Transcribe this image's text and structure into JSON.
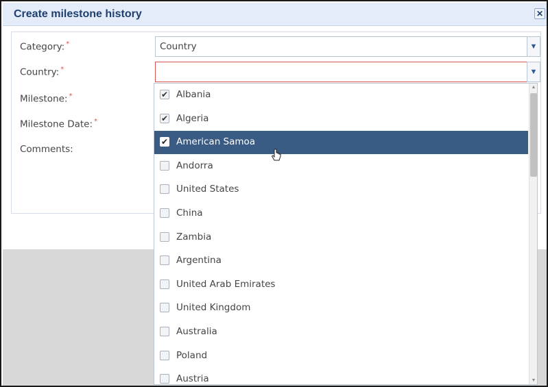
{
  "dialog": {
    "title": "Create milestone history",
    "close_glyph": "✕"
  },
  "form": {
    "category": {
      "label": "Category:",
      "required_mark": "*",
      "value": "Country"
    },
    "country": {
      "label": "Country:",
      "required_mark": "*",
      "value": ""
    },
    "milestone": {
      "label": "Milestone:",
      "required_mark": "*"
    },
    "milestone_date": {
      "label": "Milestone Date:",
      "required_mark": "*"
    },
    "comments": {
      "label": "Comments:"
    }
  },
  "dropdown": {
    "options": [
      {
        "label": "Albania",
        "checked": true
      },
      {
        "label": "Algeria",
        "checked": true
      },
      {
        "label": "American Samoa",
        "checked": true,
        "highlighted": true
      },
      {
        "label": "Andorra",
        "checked": false
      },
      {
        "label": "United States",
        "checked": false
      },
      {
        "label": "China",
        "checked": false
      },
      {
        "label": "Zambia",
        "checked": false
      },
      {
        "label": "Argentina",
        "checked": false
      },
      {
        "label": "United Arab Emirates",
        "checked": false
      },
      {
        "label": "United Kingdom",
        "checked": false
      },
      {
        "label": "Australia",
        "checked": false
      },
      {
        "label": "Poland",
        "checked": false
      },
      {
        "label": "Austria",
        "checked": false
      }
    ]
  },
  "icons": {
    "dropdown_arrow": "chevron-down-icon",
    "checkbox_checked": "✔",
    "close": "close-icon",
    "cursor": "hand-pointer-icon"
  },
  "colors": {
    "title_text": "#1f3f6e",
    "highlight_row": "#3a5b84",
    "invalid_border": "#d9534f",
    "required_mark": "#d9534f"
  }
}
